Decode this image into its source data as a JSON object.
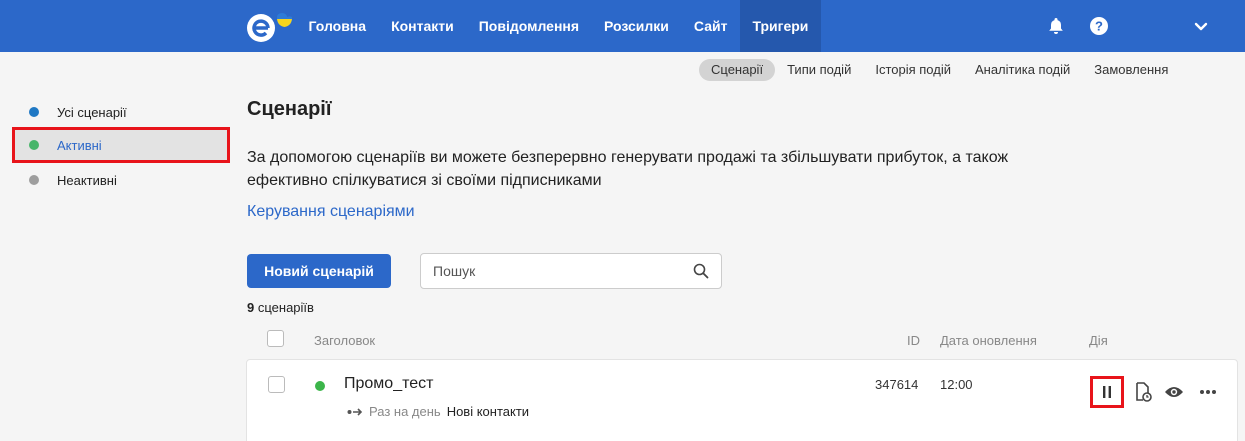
{
  "nav": {
    "items": [
      "Головна",
      "Контакти",
      "Повідомлення",
      "Розсилки",
      "Сайт",
      "Тригери"
    ],
    "active_index": 5
  },
  "subtabs": {
    "items": [
      "Сценарії",
      "Типи подій",
      "Історія подій",
      "Аналітика подій",
      "Замовлення"
    ],
    "active_index": 0
  },
  "sidebar": {
    "items": [
      {
        "label": "Усі сценарії",
        "dot_color": "#1f78c4"
      },
      {
        "label": "Активні",
        "dot_color": "#48b56a"
      },
      {
        "label": "Неактивні",
        "dot_color": "#9e9e9e"
      }
    ],
    "selected_index": 1
  },
  "main": {
    "title": "Сценарії",
    "description": "За допомогою сценаріїв ви можете безперервно генерувати продажі та збільшувати прибуток, а також ефективно спілкуватися зі своїми підписниками",
    "manage_link": "Керування сценаріями",
    "new_button": "Новий сценарій",
    "search_placeholder": "Пошук",
    "count_number": "9",
    "count_label": "сценаріїв"
  },
  "table": {
    "headers": {
      "title": "Заголовок",
      "id": "ID",
      "updated": "Дата оновлення",
      "action": "Дія"
    },
    "rows": [
      {
        "status_color": "#3cb54a",
        "name": "Промо_тест",
        "frequency": "Раз на день",
        "audience": "Нові контакти",
        "id": "347614",
        "updated": "12:00"
      }
    ]
  },
  "colors": {
    "brand": "#2c68c9",
    "highlight": "#e8141a"
  },
  "icons": [
    "logo-icon",
    "bell-icon",
    "help-icon",
    "chevron-down-icon",
    "search-icon",
    "arrow-icon",
    "pause-icon",
    "history-icon",
    "eye-icon",
    "more-icon"
  ]
}
